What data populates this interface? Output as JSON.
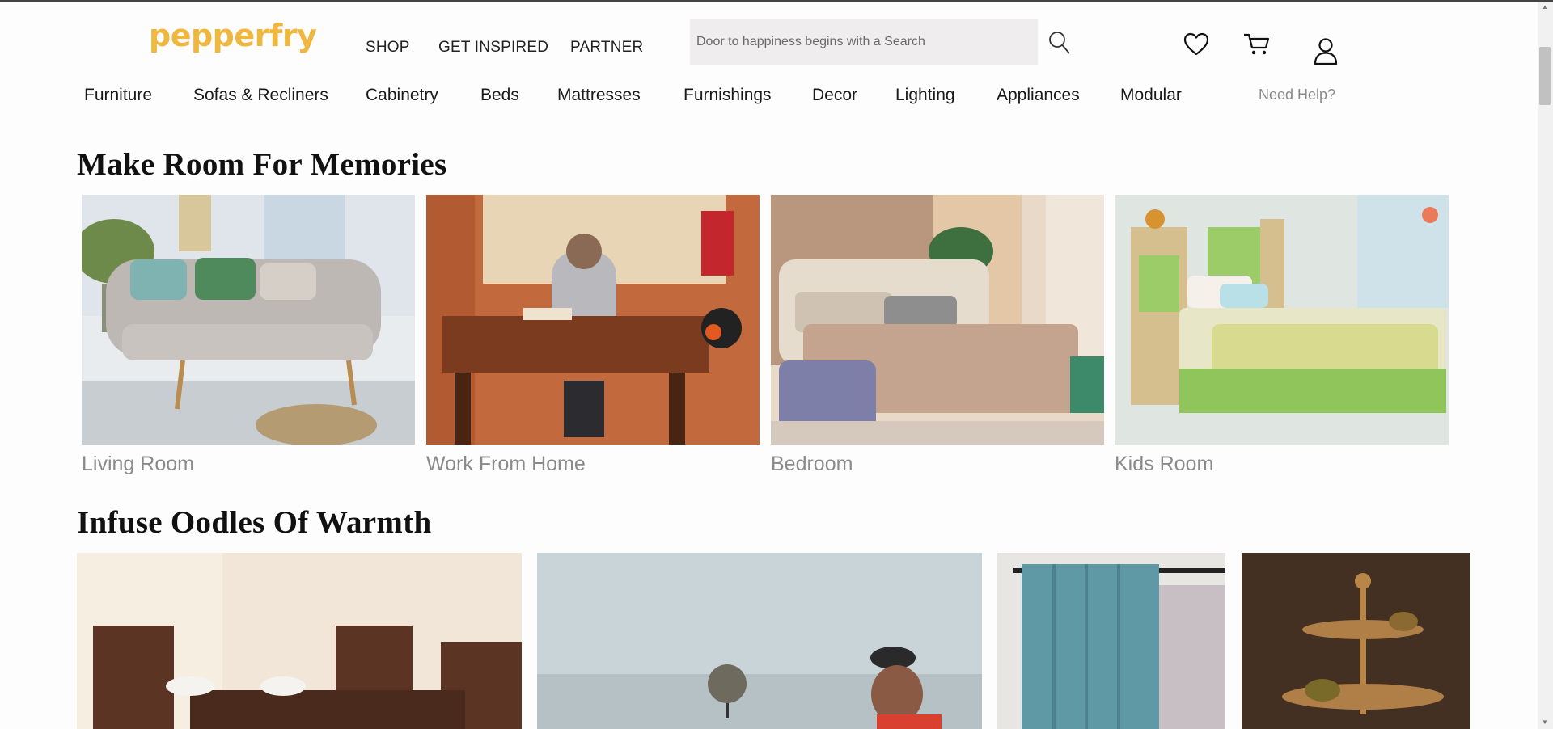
{
  "brand": {
    "logo_text": "pepperfry",
    "logo_color": "#f0b73e"
  },
  "top_nav": [
    {
      "label": "SHOP"
    },
    {
      "label": "GET INSPIRED"
    },
    {
      "label": "PARTNER"
    }
  ],
  "search": {
    "placeholder": "Door to happiness begins with a Search",
    "value": "",
    "icon": "search-icon"
  },
  "header_icons": [
    "wishlist-heart-icon",
    "cart-icon",
    "account-user-icon"
  ],
  "categories": [
    {
      "label": "Furniture"
    },
    {
      "label": "Sofas & Recliners"
    },
    {
      "label": "Cabinetry"
    },
    {
      "label": "Beds"
    },
    {
      "label": "Mattresses"
    },
    {
      "label": "Furnishings"
    },
    {
      "label": "Decor"
    },
    {
      "label": "Lighting"
    },
    {
      "label": "Appliances"
    },
    {
      "label": "Modular"
    }
  ],
  "help_link": "Need Help?",
  "sections": [
    {
      "title": "Make Room For Memories",
      "tiles": [
        {
          "label": "Living Room"
        },
        {
          "label": "Work From Home"
        },
        {
          "label": "Bedroom"
        },
        {
          "label": "Kids Room"
        }
      ]
    },
    {
      "title": "Infuse Oodles Of Warmth",
      "tiles": []
    }
  ]
}
